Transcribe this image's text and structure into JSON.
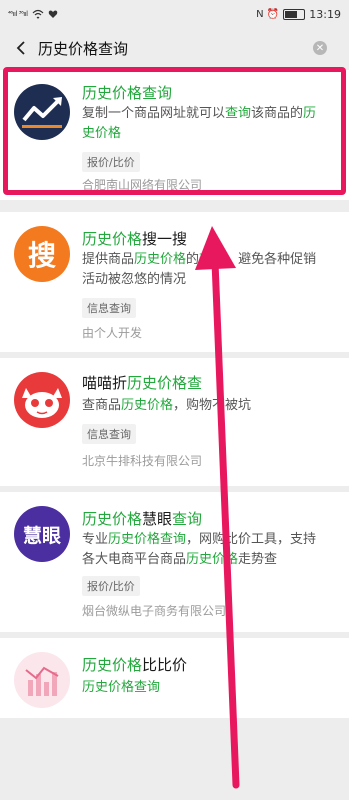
{
  "status_bar": {
    "left_signals": "⁴⁶ııl ³⁶ııl",
    "right_icons": "N ⏰",
    "battery": "",
    "time": "13:19"
  },
  "search": {
    "query": "历史价格查询"
  },
  "results": [
    {
      "title_parts": [
        {
          "t": "历史价格查询",
          "hl": true
        }
      ],
      "desc_parts": [
        {
          "t": "复制一个商品网址就可以",
          "hl": false
        },
        {
          "t": "查询",
          "hl": true
        },
        {
          "t": "该商品的",
          "hl": false
        },
        {
          "t": "历史价格",
          "hl": true
        }
      ],
      "tag": "报价/比价",
      "company": "合肥南山网络有限公司",
      "logo": "trend-chart"
    },
    {
      "title_parts": [
        {
          "t": "历史价格",
          "hl": true
        },
        {
          "t": "搜一搜",
          "hl": false
        }
      ],
      "desc_parts": [
        {
          "t": "提供商品",
          "hl": false
        },
        {
          "t": "历史价格",
          "hl": true
        },
        {
          "t": "的",
          "hl": false
        },
        {
          "t": "查询",
          "hl": true
        },
        {
          "t": "，避免各种促销活动被忽悠的情况",
          "hl": false
        }
      ],
      "tag": "信息查询",
      "company": "由个人开发",
      "logo_text": "搜",
      "logo": "sou"
    },
    {
      "title_parts": [
        {
          "t": "喵喵折",
          "hl": false
        },
        {
          "t": "历史价格查",
          "hl": true
        }
      ],
      "desc_parts": [
        {
          "t": "查商品",
          "hl": false
        },
        {
          "t": "历史价格",
          "hl": true
        },
        {
          "t": "，购物不被坑",
          "hl": false
        }
      ],
      "tag": "信息查询",
      "company": "北京牛排科技有限公司",
      "logo": "cat"
    },
    {
      "title_parts": [
        {
          "t": "历史价格",
          "hl": true
        },
        {
          "t": "慧眼",
          "hl": false
        },
        {
          "t": "查询",
          "hl": true
        }
      ],
      "desc_parts": [
        {
          "t": "专业",
          "hl": false
        },
        {
          "t": "历史价格查询",
          "hl": true
        },
        {
          "t": "，网购比价工具，支持各大电商平台商品",
          "hl": false
        },
        {
          "t": "历史价格",
          "hl": true
        },
        {
          "t": "走势查",
          "hl": false
        }
      ],
      "tag": "报价/比价",
      "company": "烟台微纵电子商务有限公司",
      "logo_text": "慧眼",
      "logo": "huiyan"
    },
    {
      "title_parts": [
        {
          "t": "历史价格",
          "hl": true
        },
        {
          "t": "比比价",
          "hl": false
        }
      ],
      "desc_parts": [
        {
          "t": "历史价格查询",
          "hl": true
        }
      ],
      "tag": "",
      "company": "",
      "logo": "bars"
    }
  ],
  "colors": {
    "highlight": "#22a83c",
    "annotation": "#e8185e"
  }
}
